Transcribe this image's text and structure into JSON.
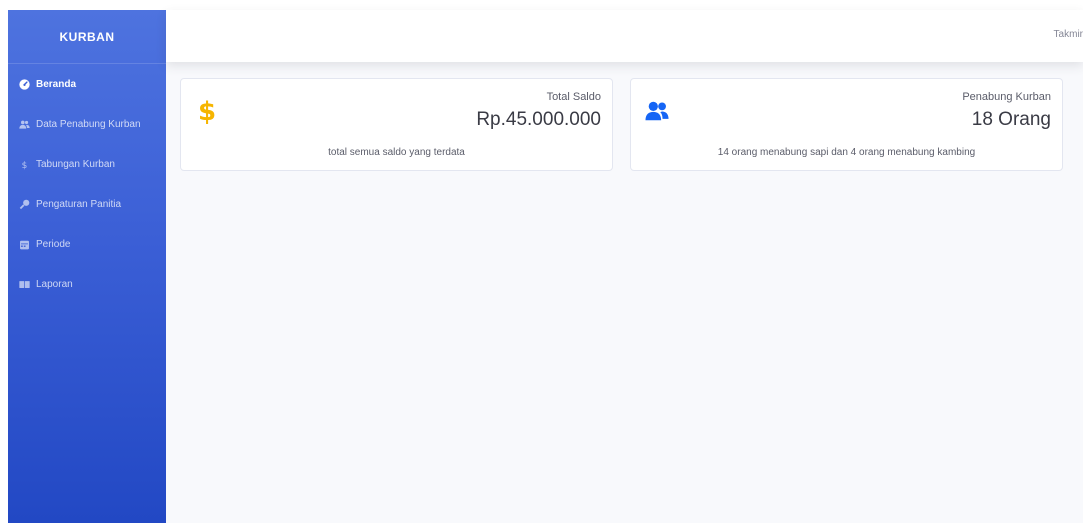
{
  "brand": "KURBAN",
  "topbar": {
    "user_label": "Takmir"
  },
  "sidebar": {
    "items": [
      {
        "label": "Beranda",
        "icon": "dashboard-icon",
        "active": true
      },
      {
        "label": "Data Penabung Kurban",
        "icon": "users-icon",
        "active": false
      },
      {
        "label": "Tabungan Kurban",
        "icon": "dollar-icon",
        "active": false
      },
      {
        "label": "Pengaturan Panitia",
        "icon": "key-icon",
        "active": false
      },
      {
        "label": "Periode",
        "icon": "calendar-icon",
        "active": false
      },
      {
        "label": "Laporan",
        "icon": "book-icon",
        "active": false
      }
    ]
  },
  "cards": {
    "saldo": {
      "label": "Total Saldo",
      "value": "Rp.45.000.000",
      "footer": "total semua saldo yang terdata",
      "icon": "dollar-sign-icon",
      "icon_color": "#f6b500"
    },
    "penabung": {
      "label": "Penabung Kurban",
      "value": "18 Orang",
      "footer": "14 orang menabung sapi dan 4 orang menabung kambing",
      "icon": "users-icon",
      "icon_color": "#1565f5"
    }
  },
  "colors": {
    "sidebar_top": "#4e73df",
    "sidebar_bottom": "#2248c4",
    "content_bg": "#f8f9fc"
  }
}
